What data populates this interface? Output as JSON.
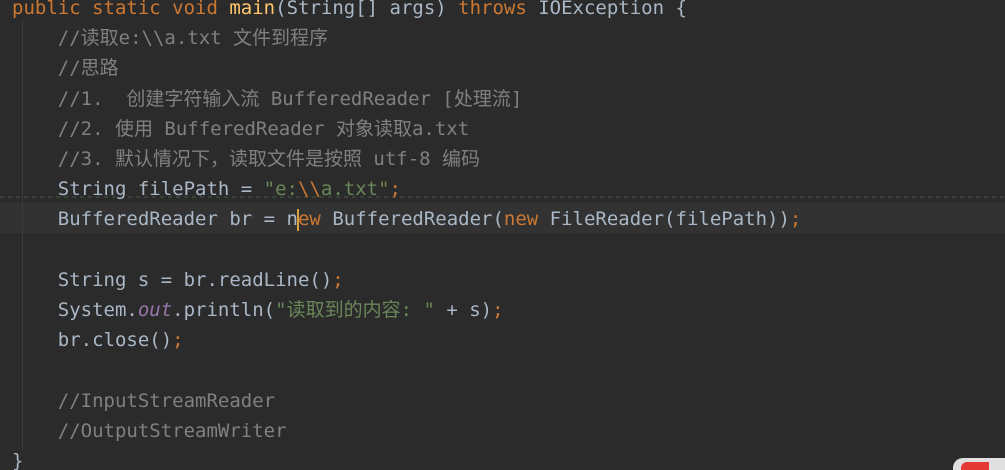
{
  "editor": {
    "language": "Java",
    "lines": [
      {
        "tokens": [
          {
            "t": "public ",
            "c": "kw"
          },
          {
            "t": "static ",
            "c": "kw"
          },
          {
            "t": "void ",
            "c": "kw"
          },
          {
            "t": "main",
            "c": "fn"
          },
          {
            "t": "(String[] args) ",
            "c": "plain"
          },
          {
            "t": "throws ",
            "c": "kw"
          },
          {
            "t": "IOException {",
            "c": "plain"
          }
        ]
      },
      {
        "tokens": [
          {
            "t": "    //读取e:\\\\a.txt 文件到程序",
            "c": "com"
          }
        ]
      },
      {
        "tokens": [
          {
            "t": "    //思路",
            "c": "com"
          }
        ]
      },
      {
        "tokens": [
          {
            "t": "    //1.  创建字符输入流 BufferedReader [处理流]",
            "c": "com"
          }
        ]
      },
      {
        "tokens": [
          {
            "t": "    //2. 使用 BufferedReader 对象读取a.txt",
            "c": "com"
          }
        ]
      },
      {
        "tokens": [
          {
            "t": "    //3. 默认情况下，读取文件是按照 utf-8 编码",
            "c": "com"
          }
        ]
      },
      {
        "tokens": [
          {
            "t": "    String filePath = ",
            "c": "plain"
          },
          {
            "t": "\"e:",
            "c": "str"
          },
          {
            "t": "\\\\",
            "c": "kw"
          },
          {
            "t": "a.txt\"",
            "c": "str"
          },
          {
            "t": ";",
            "c": "kw"
          }
        ]
      },
      {
        "tokens": [
          {
            "t": "    BufferedReader br = n",
            "c": "plain"
          },
          {
            "t": "",
            "c": "caret"
          },
          {
            "t": "ew ",
            "c": "kw"
          },
          {
            "t": "BufferedReader(",
            "c": "plain"
          },
          {
            "t": "new ",
            "c": "kw"
          },
          {
            "t": "FileReader(filePath))",
            "c": "plain"
          },
          {
            "t": ";",
            "c": "kw"
          }
        ]
      },
      {
        "tokens": []
      },
      {
        "tokens": [
          {
            "t": "    String s = br.readLine()",
            "c": "plain"
          },
          {
            "t": ";",
            "c": "kw"
          }
        ]
      },
      {
        "tokens": [
          {
            "t": "    System.",
            "c": "plain"
          },
          {
            "t": "out",
            "c": "field"
          },
          {
            "t": ".println(",
            "c": "plain"
          },
          {
            "t": "\"读取到的内容: \"",
            "c": "str"
          },
          {
            "t": " + s)",
            "c": "plain"
          },
          {
            "t": ";",
            "c": "kw"
          }
        ]
      },
      {
        "tokens": [
          {
            "t": "    br.close()",
            "c": "plain"
          },
          {
            "t": ";",
            "c": "kw"
          }
        ]
      },
      {
        "tokens": []
      },
      {
        "tokens": [
          {
            "t": "    //InputStreamReader",
            "c": "com"
          }
        ]
      },
      {
        "tokens": [
          {
            "t": "    //OutputStreamWriter",
            "c": "com"
          }
        ]
      },
      {
        "tokens": [
          {
            "t": "}",
            "c": "plain"
          }
        ]
      }
    ]
  }
}
